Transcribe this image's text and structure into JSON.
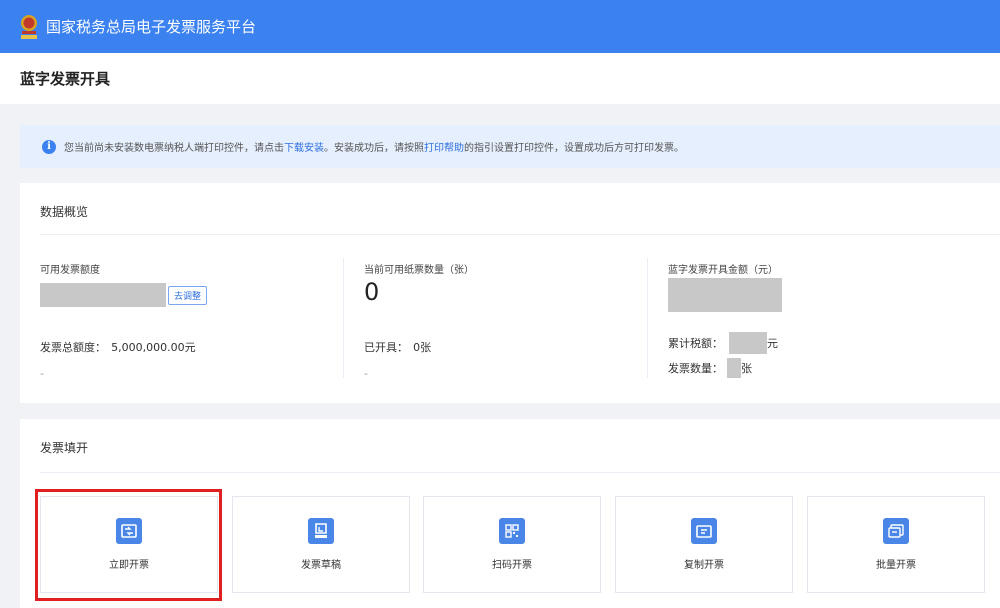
{
  "topbar": {
    "title": "国家税务总局电子发票服务平台",
    "logo": "tax-emblem-icon"
  },
  "page": {
    "title": "蓝字发票开具"
  },
  "notice": {
    "text_before": "您当前尚未安装数电票纳税人端打印控件，请点击",
    "link1": "下载安装",
    "text_mid": "。安装成功后，请按照",
    "link2": "打印帮助",
    "text_after": "的指引设置打印控件，设置成功后方可打印发票。"
  },
  "overview": {
    "title": "数据概览",
    "available_quota": {
      "label": "可用发票额度",
      "adjust_label": "去调整",
      "total_label": "发票总额度：",
      "total_value": "5,000,000.00元",
      "dash": "-"
    },
    "paper_count": {
      "label": "当前可用纸票数量（张）",
      "value": "0",
      "issued_label": "已开具：",
      "issued_value": "0张",
      "dash": "-"
    },
    "blue_amount": {
      "label": "蓝字发票开具金额（元）",
      "tax_label": "累计税额：",
      "tax_unit": "元",
      "count_label": "发票数量：",
      "count_unit": "张"
    }
  },
  "fill": {
    "title": "发票填开",
    "tiles": [
      {
        "label": "立即开票",
        "icon": "issue-invoice-icon"
      },
      {
        "label": "发票草稿",
        "icon": "invoice-draft-icon"
      },
      {
        "label": "扫码开票",
        "icon": "qr-code-icon"
      },
      {
        "label": "复制开票",
        "icon": "copy-invoice-icon"
      },
      {
        "label": "批量开票",
        "icon": "batch-invoice-icon"
      }
    ]
  },
  "colors": {
    "primary": "#3b82f0",
    "highlight": "#e02020"
  }
}
